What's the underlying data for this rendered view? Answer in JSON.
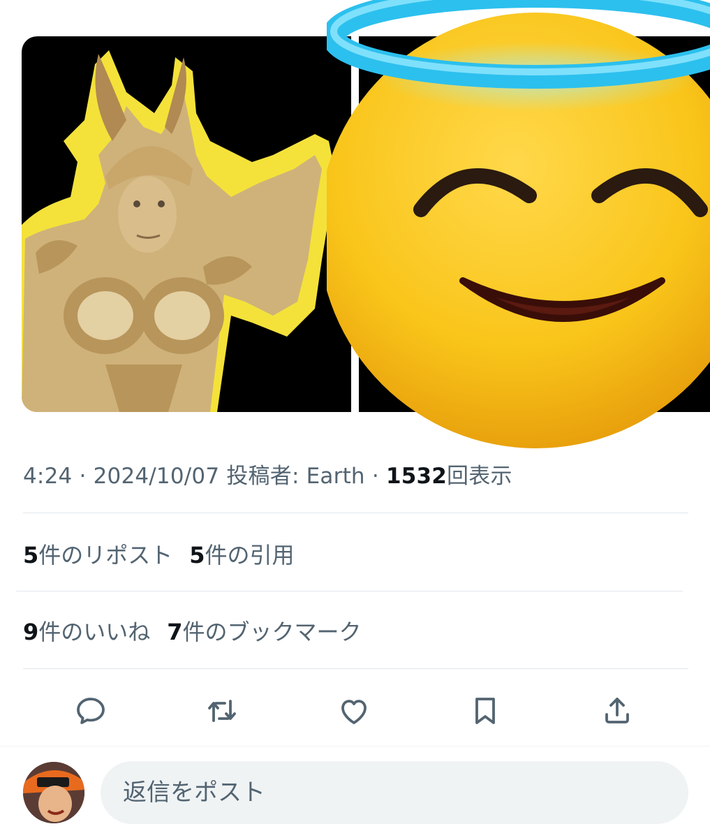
{
  "tweet": {
    "time": "4:24",
    "separator": " · ",
    "date": "2024/10/07",
    "posted_by": "投稿者: Earth",
    "views_count": "1532",
    "views_label": "回表示"
  },
  "stats": {
    "reposts_count": "5",
    "reposts_label": "件のリポスト",
    "quotes_count": "5",
    "quotes_label": "件の引用",
    "likes_count": "9",
    "likes_label": "件のいいね",
    "bookmarks_count": "7",
    "bookmarks_label": "件のブックマーク"
  },
  "actions": [
    "reply-icon",
    "repost-icon",
    "like-icon",
    "bookmark-icon",
    "share-icon"
  ],
  "reply": {
    "placeholder": "返信をポスト"
  },
  "colors": {
    "text_secondary": "#536471",
    "text_primary": "#0f1419",
    "divider": "#e1e6ea",
    "input_bg": "#eff3f4",
    "emoji_yellow": "#f9c51a",
    "halo": "#33c8f2",
    "costume_gold": "#cfb27a",
    "outline_yellow": "#f4e23a"
  }
}
